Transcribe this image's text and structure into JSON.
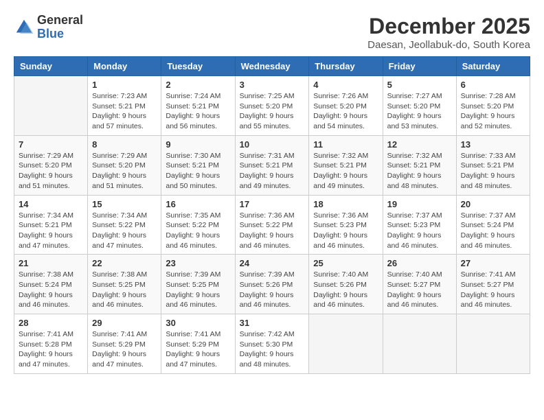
{
  "logo": {
    "general": "General",
    "blue": "Blue"
  },
  "title": "December 2025",
  "location": "Daesan, Jeollabuk-do, South Korea",
  "days_of_week": [
    "Sunday",
    "Monday",
    "Tuesday",
    "Wednesday",
    "Thursday",
    "Friday",
    "Saturday"
  ],
  "weeks": [
    [
      {
        "day": "",
        "info": ""
      },
      {
        "day": "1",
        "info": "Sunrise: 7:23 AM\nSunset: 5:21 PM\nDaylight: 9 hours\nand 57 minutes."
      },
      {
        "day": "2",
        "info": "Sunrise: 7:24 AM\nSunset: 5:21 PM\nDaylight: 9 hours\nand 56 minutes."
      },
      {
        "day": "3",
        "info": "Sunrise: 7:25 AM\nSunset: 5:20 PM\nDaylight: 9 hours\nand 55 minutes."
      },
      {
        "day": "4",
        "info": "Sunrise: 7:26 AM\nSunset: 5:20 PM\nDaylight: 9 hours\nand 54 minutes."
      },
      {
        "day": "5",
        "info": "Sunrise: 7:27 AM\nSunset: 5:20 PM\nDaylight: 9 hours\nand 53 minutes."
      },
      {
        "day": "6",
        "info": "Sunrise: 7:28 AM\nSunset: 5:20 PM\nDaylight: 9 hours\nand 52 minutes."
      }
    ],
    [
      {
        "day": "7",
        "info": "Sunrise: 7:29 AM\nSunset: 5:20 PM\nDaylight: 9 hours\nand 51 minutes."
      },
      {
        "day": "8",
        "info": "Sunrise: 7:29 AM\nSunset: 5:20 PM\nDaylight: 9 hours\nand 51 minutes."
      },
      {
        "day": "9",
        "info": "Sunrise: 7:30 AM\nSunset: 5:21 PM\nDaylight: 9 hours\nand 50 minutes."
      },
      {
        "day": "10",
        "info": "Sunrise: 7:31 AM\nSunset: 5:21 PM\nDaylight: 9 hours\nand 49 minutes."
      },
      {
        "day": "11",
        "info": "Sunrise: 7:32 AM\nSunset: 5:21 PM\nDaylight: 9 hours\nand 49 minutes."
      },
      {
        "day": "12",
        "info": "Sunrise: 7:32 AM\nSunset: 5:21 PM\nDaylight: 9 hours\nand 48 minutes."
      },
      {
        "day": "13",
        "info": "Sunrise: 7:33 AM\nSunset: 5:21 PM\nDaylight: 9 hours\nand 48 minutes."
      }
    ],
    [
      {
        "day": "14",
        "info": "Sunrise: 7:34 AM\nSunset: 5:21 PM\nDaylight: 9 hours\nand 47 minutes."
      },
      {
        "day": "15",
        "info": "Sunrise: 7:34 AM\nSunset: 5:22 PM\nDaylight: 9 hours\nand 47 minutes."
      },
      {
        "day": "16",
        "info": "Sunrise: 7:35 AM\nSunset: 5:22 PM\nDaylight: 9 hours\nand 46 minutes."
      },
      {
        "day": "17",
        "info": "Sunrise: 7:36 AM\nSunset: 5:22 PM\nDaylight: 9 hours\nand 46 minutes."
      },
      {
        "day": "18",
        "info": "Sunrise: 7:36 AM\nSunset: 5:23 PM\nDaylight: 9 hours\nand 46 minutes."
      },
      {
        "day": "19",
        "info": "Sunrise: 7:37 AM\nSunset: 5:23 PM\nDaylight: 9 hours\nand 46 minutes."
      },
      {
        "day": "20",
        "info": "Sunrise: 7:37 AM\nSunset: 5:24 PM\nDaylight: 9 hours\nand 46 minutes."
      }
    ],
    [
      {
        "day": "21",
        "info": "Sunrise: 7:38 AM\nSunset: 5:24 PM\nDaylight: 9 hours\nand 46 minutes."
      },
      {
        "day": "22",
        "info": "Sunrise: 7:38 AM\nSunset: 5:25 PM\nDaylight: 9 hours\nand 46 minutes."
      },
      {
        "day": "23",
        "info": "Sunrise: 7:39 AM\nSunset: 5:25 PM\nDaylight: 9 hours\nand 46 minutes."
      },
      {
        "day": "24",
        "info": "Sunrise: 7:39 AM\nSunset: 5:26 PM\nDaylight: 9 hours\nand 46 minutes."
      },
      {
        "day": "25",
        "info": "Sunrise: 7:40 AM\nSunset: 5:26 PM\nDaylight: 9 hours\nand 46 minutes."
      },
      {
        "day": "26",
        "info": "Sunrise: 7:40 AM\nSunset: 5:27 PM\nDaylight: 9 hours\nand 46 minutes."
      },
      {
        "day": "27",
        "info": "Sunrise: 7:41 AM\nSunset: 5:27 PM\nDaylight: 9 hours\nand 46 minutes."
      }
    ],
    [
      {
        "day": "28",
        "info": "Sunrise: 7:41 AM\nSunset: 5:28 PM\nDaylight: 9 hours\nand 47 minutes."
      },
      {
        "day": "29",
        "info": "Sunrise: 7:41 AM\nSunset: 5:29 PM\nDaylight: 9 hours\nand 47 minutes."
      },
      {
        "day": "30",
        "info": "Sunrise: 7:41 AM\nSunset: 5:29 PM\nDaylight: 9 hours\nand 47 minutes."
      },
      {
        "day": "31",
        "info": "Sunrise: 7:42 AM\nSunset: 5:30 PM\nDaylight: 9 hours\nand 48 minutes."
      },
      {
        "day": "",
        "info": ""
      },
      {
        "day": "",
        "info": ""
      },
      {
        "day": "",
        "info": ""
      }
    ]
  ]
}
